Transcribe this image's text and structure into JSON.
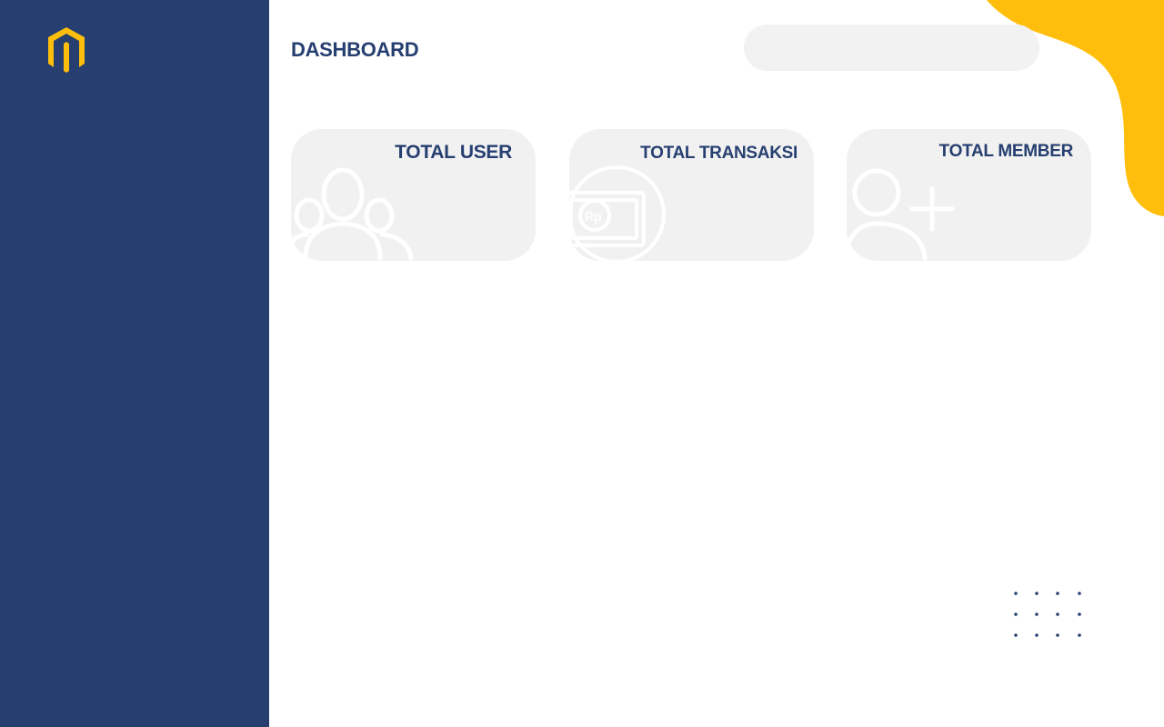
{
  "header": {
    "title": "DASHBOARD",
    "search_placeholder": ""
  },
  "cards": [
    {
      "title": "TOTAL USER",
      "icon": "users-group-icon"
    },
    {
      "title": "TOTAL TRANSAKSI",
      "icon": "money-rp-icon"
    },
    {
      "title": "TOTAL MEMBER",
      "icon": "add-user-icon"
    }
  ],
  "colors": {
    "sidebar": "#263f70",
    "accent": "#ffbe0b",
    "card_bg": "#f1f1f1",
    "title_text": "#263f70"
  }
}
